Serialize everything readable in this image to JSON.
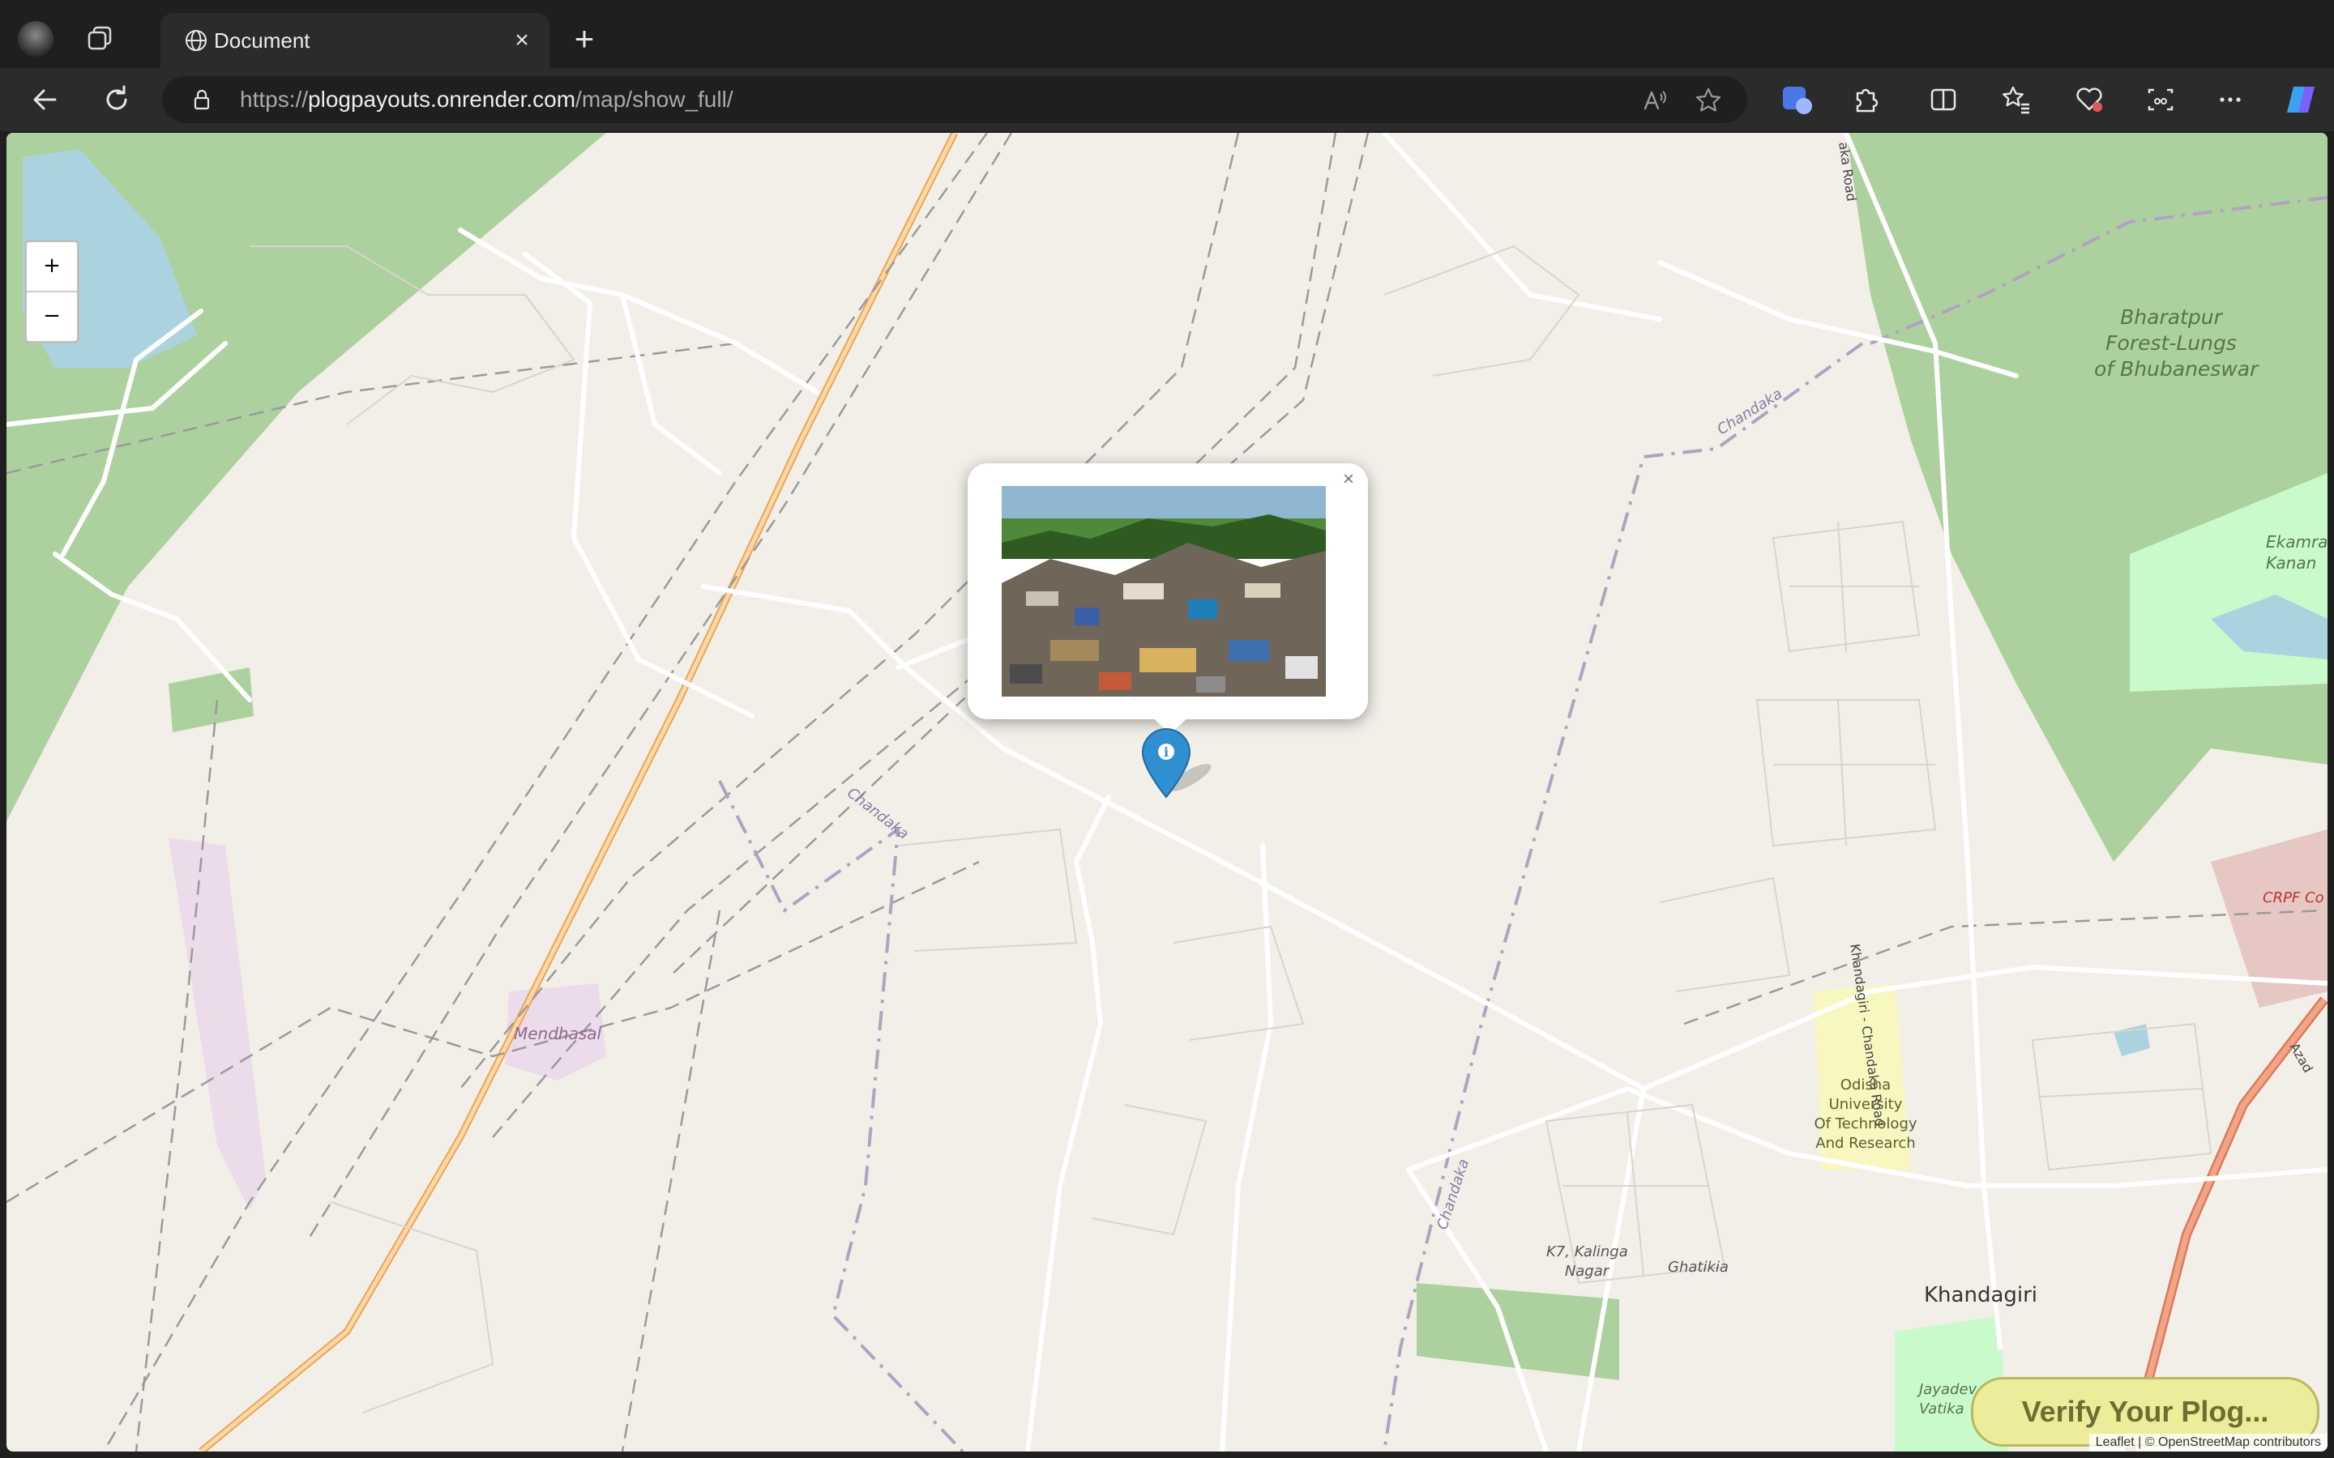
{
  "tab": {
    "title": "Document",
    "close": "×",
    "new": "+"
  },
  "address": {
    "scheme": "https://",
    "host": "plogpayouts.onrender.com",
    "path": "/map/show_full/"
  },
  "map": {
    "zoom_in": "+",
    "zoom_out": "−",
    "labels": {
      "bharatpur": [
        "Bharatpur",
        "Forest-Lungs",
        "of Bhubaneswar"
      ],
      "ekamra": [
        "Ekamra",
        "Kanan"
      ],
      "crpf": "CRPF Co",
      "chandaka1": "Chandaka",
      "chandaka2": "Chandaka",
      "chandaka3": "Chandaka",
      "mendhasal": "Mendhasal",
      "khandagiri_rd": "Khandagiri - Chandaka Road",
      "odisha_univ": [
        "Odisha",
        "University",
        "Of Technology",
        "And Research"
      ],
      "k7": [
        "K7, Kalinga",
        "Nagar"
      ],
      "ghatikia": "Ghatikia",
      "khandagiri": "Khandagiri",
      "jayadev": [
        "Jayadev",
        "Vatika"
      ],
      "road_top": "aka Road",
      "azad": "Azad"
    },
    "popup_close": "×",
    "verify_button": "Verify Your Plog...",
    "attribution": "Leaflet | © OpenStreetMap contributors"
  },
  "colors": {
    "forest": "#add19e",
    "water": "#aad3df",
    "marker": "#2f8fd0",
    "verify_bg": "#ecec9a"
  }
}
